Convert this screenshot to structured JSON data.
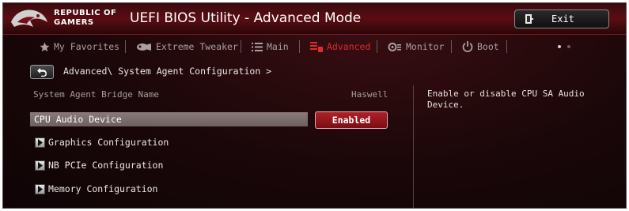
{
  "app": {
    "brand_line1": "REPUBLIC OF",
    "brand_line2": "GAMERS",
    "title": "UEFI BIOS Utility - Advanced Mode",
    "exit_label": "Exit"
  },
  "tabs": [
    {
      "label": "My Favorites",
      "icon": "star-icon",
      "active": false
    },
    {
      "label": "Extreme Tweaker",
      "icon": "tweaker-icon",
      "active": false
    },
    {
      "label": "Main",
      "icon": "list-icon",
      "active": false
    },
    {
      "label": "Advanced",
      "icon": "advanced-icon",
      "active": true
    },
    {
      "label": "Monitor",
      "icon": "monitor-icon",
      "active": false
    },
    {
      "label": "Boot",
      "icon": "power-icon",
      "active": false
    }
  ],
  "breadcrumb": "Advanced\\ System Agent Configuration >",
  "info": {
    "label": "System Agent Bridge Name",
    "value": "Haswell"
  },
  "selected_item": {
    "label": "CPU Audio Device",
    "value": "Enabled"
  },
  "submenus": [
    "Graphics Configuration",
    "NB PCIe Configuration",
    "Memory Configuration"
  ],
  "help_text": "Enable or disable CPU SA Audio\nDevice.",
  "colors": {
    "accent": "#e12a2a",
    "background": "#1a0709",
    "selected_row": "#7a6a6a",
    "value_button": "#a01a20"
  }
}
